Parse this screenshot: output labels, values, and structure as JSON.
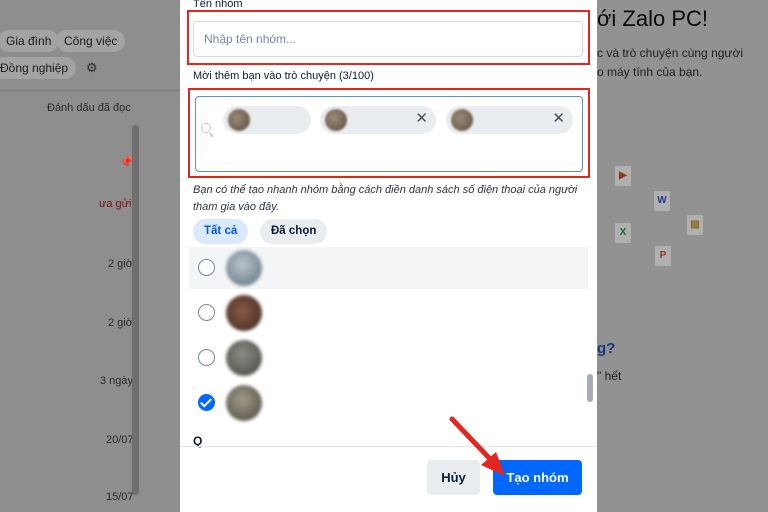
{
  "background": {
    "chips": [
      "Gia đình",
      "Công việc",
      "Đồng nghiệp"
    ],
    "mark_read": "Đánh dấu đã đọc",
    "times": [
      "2 giờ",
      "2 giờ",
      "3 ngày",
      "20/07",
      "15/07"
    ],
    "unsent_fragment": "ưa gửi",
    "welcome": "ới Zalo PC!",
    "welcome_sub_1": "c và trò chuyện cùng người",
    "welcome_sub_2": "o máy tính của bạn.",
    "question_fragment": "g?",
    "hint_fragment": "\" hết"
  },
  "modal": {
    "group_name_label": "Tên nhóm",
    "group_name_placeholder": "Nhập tên nhóm...",
    "members_label": "Mời thêm bạn vào trò chuyện (3/100)",
    "selected_count": 3,
    "hint": "Bạn có thể tạo nhanh nhóm bằng cách điền danh sách số điện thoại của người tham gia vào đây.",
    "tabs": [
      {
        "label": "Tất cả",
        "active": true
      },
      {
        "label": "Đã chọn",
        "active": false
      }
    ],
    "contacts": [
      {
        "checked": false
      },
      {
        "checked": false
      },
      {
        "checked": false
      },
      {
        "checked": true
      }
    ],
    "section_letter": "Q",
    "cancel_label": "Hủy",
    "create_label": "Tạo nhóm"
  },
  "colors": {
    "accent": "#0068ff",
    "annotation_red": "#e52520"
  },
  "icons": {
    "remove": "close-icon",
    "search": "search-icon",
    "check": "check-icon"
  }
}
